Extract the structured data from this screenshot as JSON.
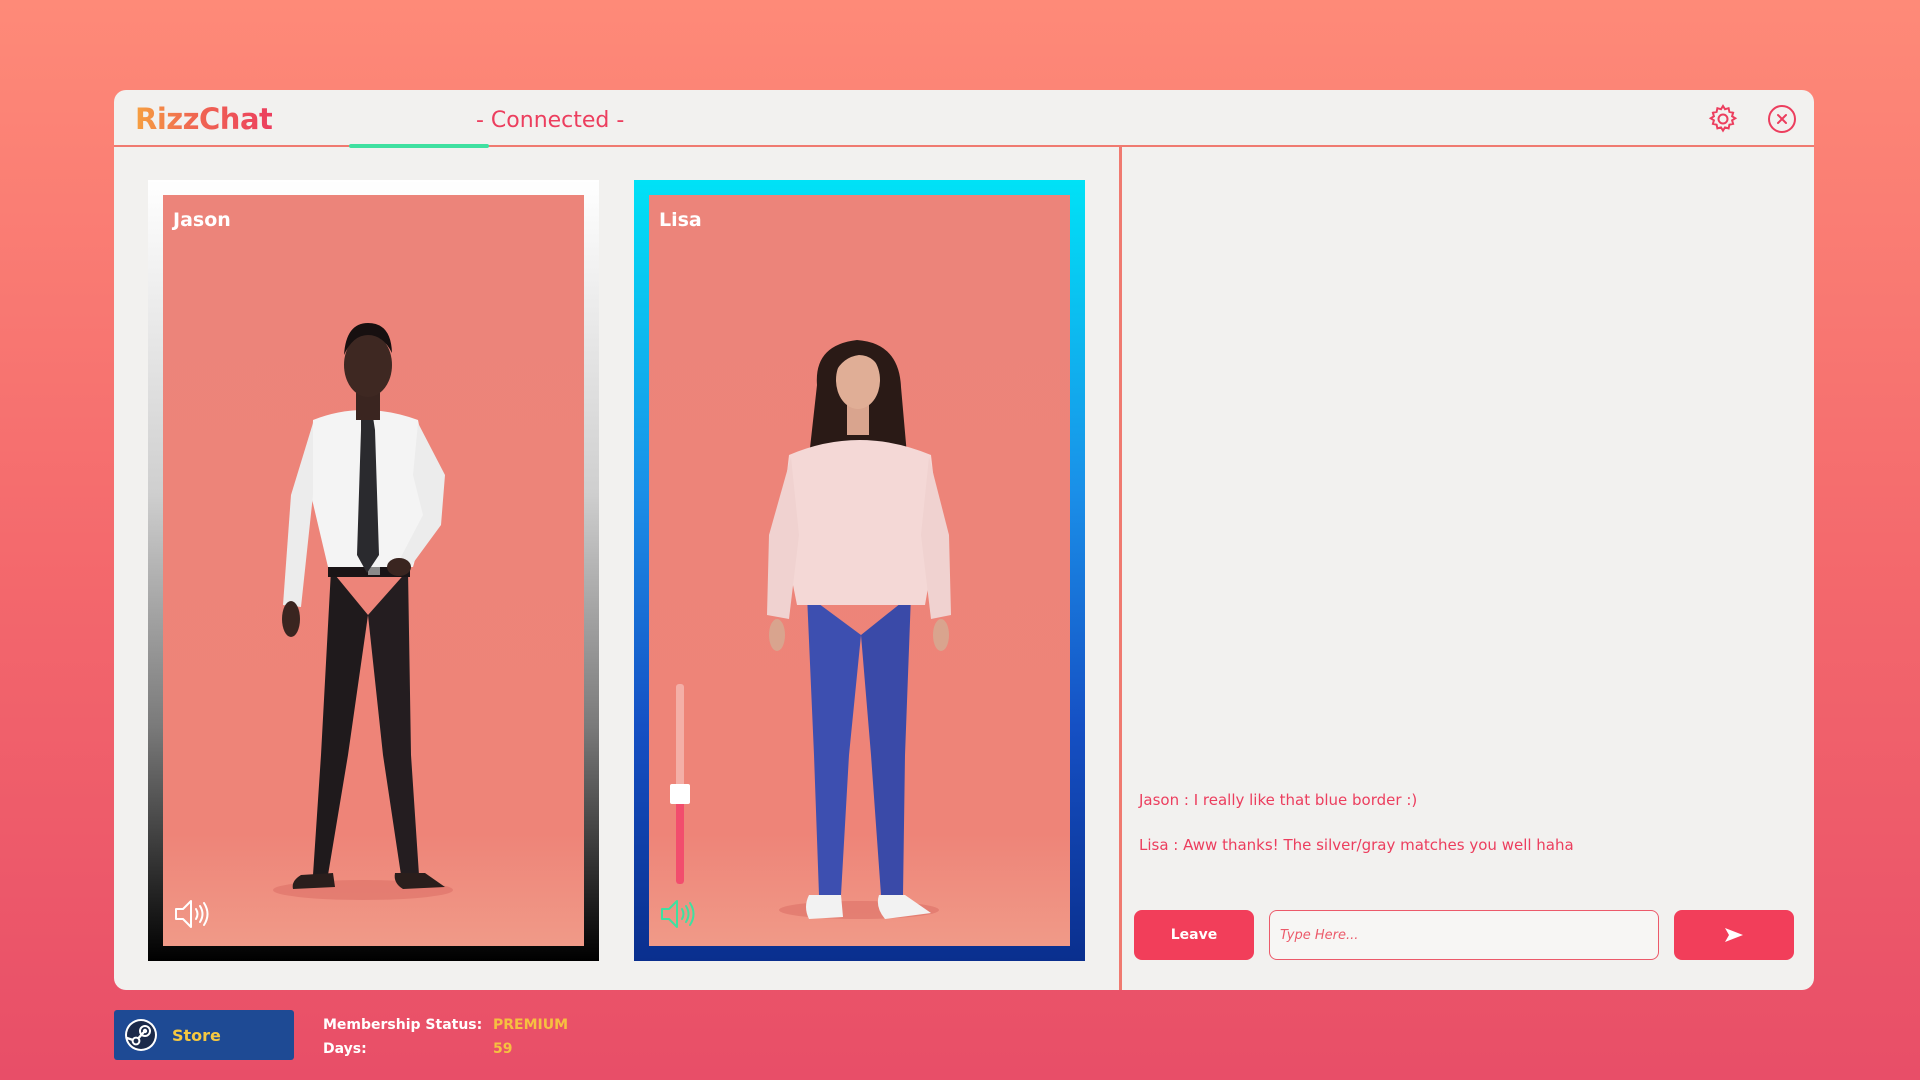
{
  "app": {
    "name": "RizzChat",
    "status": "- Connected -"
  },
  "participants": [
    {
      "name": "Jason",
      "border": "silver-gradient"
    },
    {
      "name": "Lisa",
      "border": "blue-gradient",
      "volume_level": 0.45
    }
  ],
  "chat": {
    "messages": [
      {
        "text": "Jason : I really like that blue border :)"
      },
      {
        "text": "Lisa : Aww thanks! The silver/gray matches you well haha"
      }
    ],
    "leave_label": "Leave",
    "input_placeholder": "Type Here...",
    "send_icon": "send-arrow-icon"
  },
  "footer": {
    "store_label": "Store",
    "membership_status_label": "Membership Status:",
    "membership_status_value": "PREMIUM",
    "days_label": "Days:",
    "days_value": "59"
  },
  "colors": {
    "accent": "#f23e5a",
    "tab_underline": "#3fe0a0",
    "gold": "#f6c040",
    "store_bg": "#1e4a94"
  }
}
